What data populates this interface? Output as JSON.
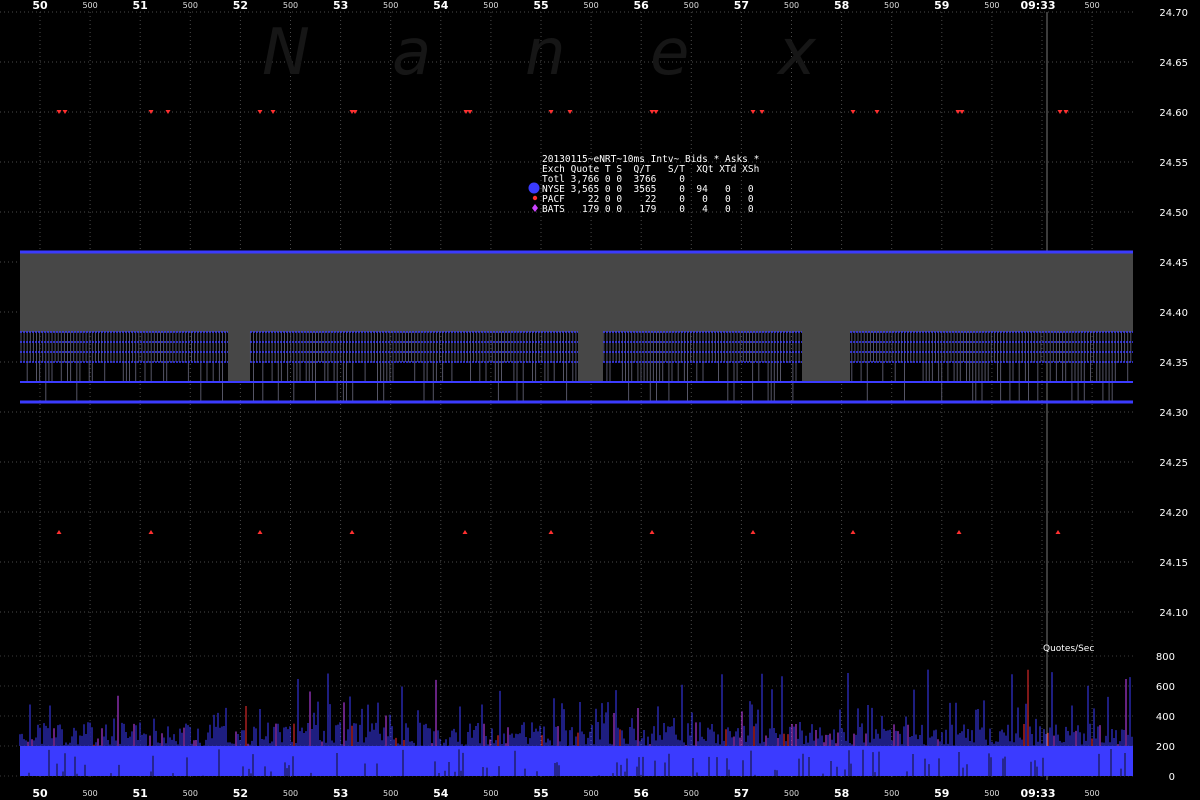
{
  "chart_data": {
    "type": "line",
    "watermark": [
      "N",
      "a",
      "n",
      "e",
      "x"
    ],
    "x_major_ticks": [
      "50",
      "51",
      "52",
      "53",
      "54",
      "55",
      "56",
      "57",
      "58",
      "59",
      "09:33"
    ],
    "x_minor_tick_label": "500",
    "price_axis": {
      "ylim": [
        24.1,
        24.7
      ],
      "ticks": [
        "24.70",
        "24.65",
        "24.60",
        "24.55",
        "24.50",
        "24.45",
        "24.40",
        "24.35",
        "24.30",
        "24.25",
        "24.20",
        "24.15",
        "24.10"
      ],
      "grid": true
    },
    "volume_axis": {
      "title": "Quotes/Sec",
      "ylim": [
        0,
        800
      ],
      "ticks": [
        "800",
        "600",
        "400",
        "200",
        "0"
      ]
    },
    "legend": {
      "header": "20130115~eNRT~10ms Intv~ Bids * Asks *",
      "columns": "Exch Quote T S  Q/T   S/T  XQt XTd XSh",
      "rows": [
        {
          "symbol": "none",
          "color": "",
          "text": "Totl 3,766 0 0  3766    0"
        },
        {
          "symbol": "circle",
          "color": "#3b3bff",
          "text": "NYSE 3,565 0 0  3565    0  94   0   0"
        },
        {
          "symbol": "dot",
          "color": "#ff3030",
          "text": "PACF    22 0 0    22    0   0   0   0"
        },
        {
          "symbol": "diamond",
          "color": "#cc44ff",
          "text": "BATS   179 0 0   179    0   4   0   0"
        }
      ]
    },
    "series": [
      {
        "name": "NYSE",
        "best_ask": 24.46,
        "best_bid": 24.31,
        "inner_levels": [
          24.38,
          24.37,
          24.36,
          24.35,
          24.33
        ],
        "color": "#3b3bff"
      },
      {
        "name": "PACF",
        "ask_marks": 24.6,
        "bid_marks": 24.18,
        "color": "#ff3030"
      },
      {
        "name": "BATS",
        "color": "#cc44ff"
      }
    ],
    "colors": {
      "spread_fill": "#474747",
      "grid": "#555555",
      "background": "#000000"
    }
  }
}
